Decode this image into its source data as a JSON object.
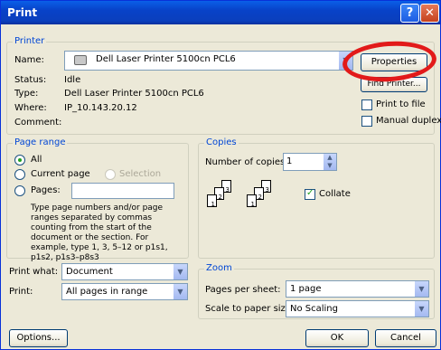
{
  "window": {
    "title": "Print",
    "help_glyph": "?",
    "close_glyph": "✕"
  },
  "printer": {
    "legend": "Printer",
    "name_label": "Name:",
    "name_value": "Dell Laser Printer 5100cn PCL6",
    "status_label": "Status:",
    "status_value": "Idle",
    "type_label": "Type:",
    "type_value": "Dell Laser Printer 5100cn PCL6",
    "where_label": "Where:",
    "where_value": "IP_10.143.20.12",
    "comment_label": "Comment:",
    "properties_label": "Properties",
    "find_printer_label": "Find Printer...",
    "print_to_file_label": "Print to file",
    "manual_duplex_label": "Manual duplex"
  },
  "page_range": {
    "legend": "Page range",
    "all_label": "All",
    "current_page_label": "Current page",
    "selection_label": "Selection",
    "pages_label": "Pages:",
    "help_text": "Type page numbers and/or page ranges separated by commas counting from the start of the document or the section. For example, type 1, 3, 5–12 or p1s1, p1s2, p1s3–p8s3"
  },
  "copies": {
    "legend": "Copies",
    "number_label": "Number of copies:",
    "number_value": "1",
    "collate_label": "Collate",
    "collate_checked": true
  },
  "print_what": {
    "label": "Print what:",
    "value": "Document"
  },
  "print": {
    "label": "Print:",
    "value": "All pages in range"
  },
  "zoom": {
    "legend": "Zoom",
    "pages_per_sheet_label": "Pages per sheet:",
    "pages_per_sheet_value": "1 page",
    "scale_label": "Scale to paper size:",
    "scale_value": "No Scaling"
  },
  "footer": {
    "options_label": "Options...",
    "ok_label": "OK",
    "cancel_label": "Cancel"
  },
  "annotation": {
    "highlight_color": "#e21a1a"
  }
}
